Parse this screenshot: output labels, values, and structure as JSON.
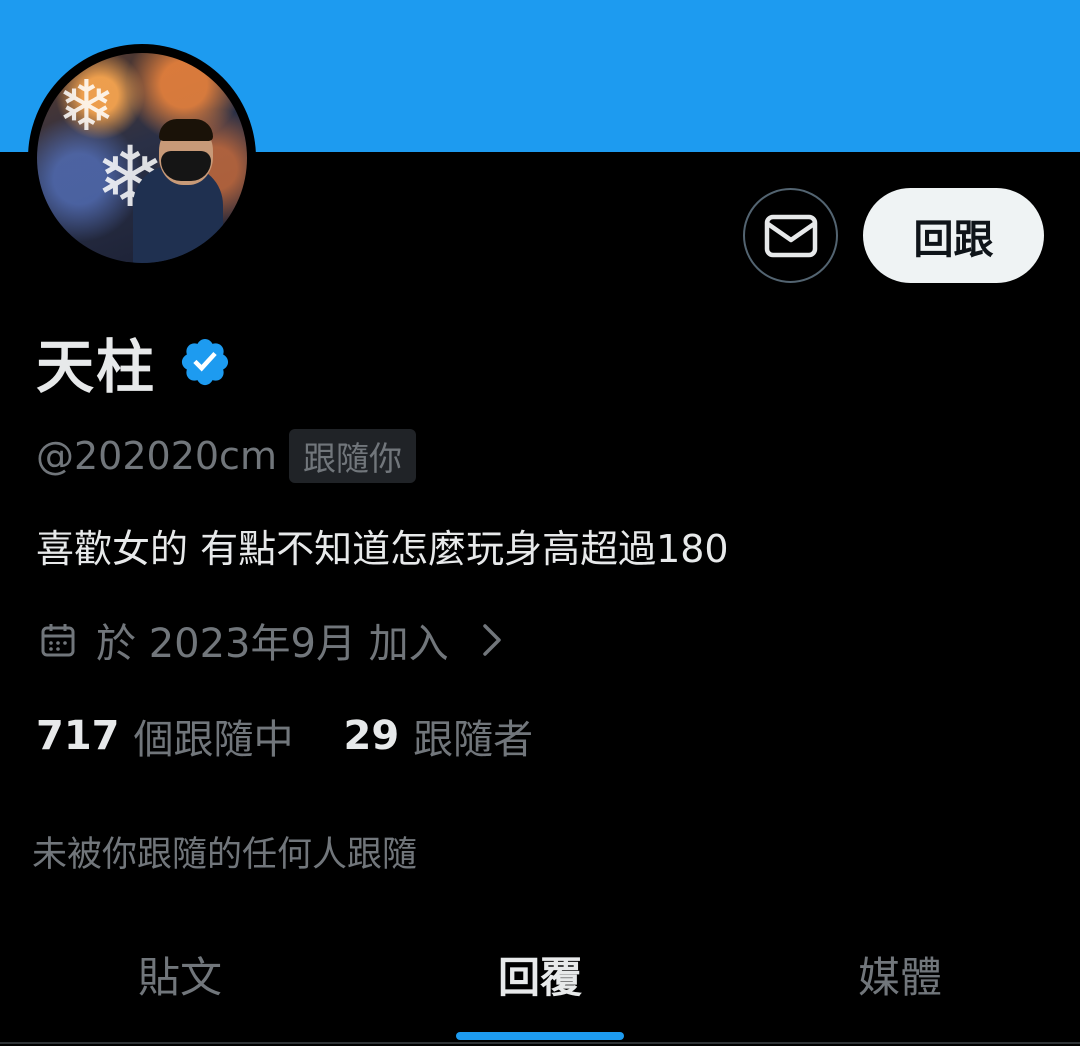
{
  "colors": {
    "banner": "#1d9bf0",
    "background": "#000000",
    "accent": "#1d9bf0",
    "primary_text": "#e7e9ea",
    "secondary_text": "#71767b"
  },
  "header": {
    "mail_icon": "mail-icon",
    "follow_back_label": "回跟"
  },
  "profile": {
    "display_name": "天柱",
    "verified_icon": "verified-badge-icon",
    "handle": "@202020cm",
    "follows_you_label": "跟隨你",
    "bio": "喜歡女的 有點不知道怎麼玩身高超過180",
    "joined": "於 2023年9月 加入",
    "following_count": "717",
    "following_label": "個跟隨中",
    "followers_count": "29",
    "followers_label": "跟隨者",
    "followers_you_know": "未被你跟隨的任何人跟隨"
  },
  "tabs": [
    {
      "label": "貼文",
      "active": false
    },
    {
      "label": "回覆",
      "active": true
    },
    {
      "label": "媒體",
      "active": false
    }
  ]
}
